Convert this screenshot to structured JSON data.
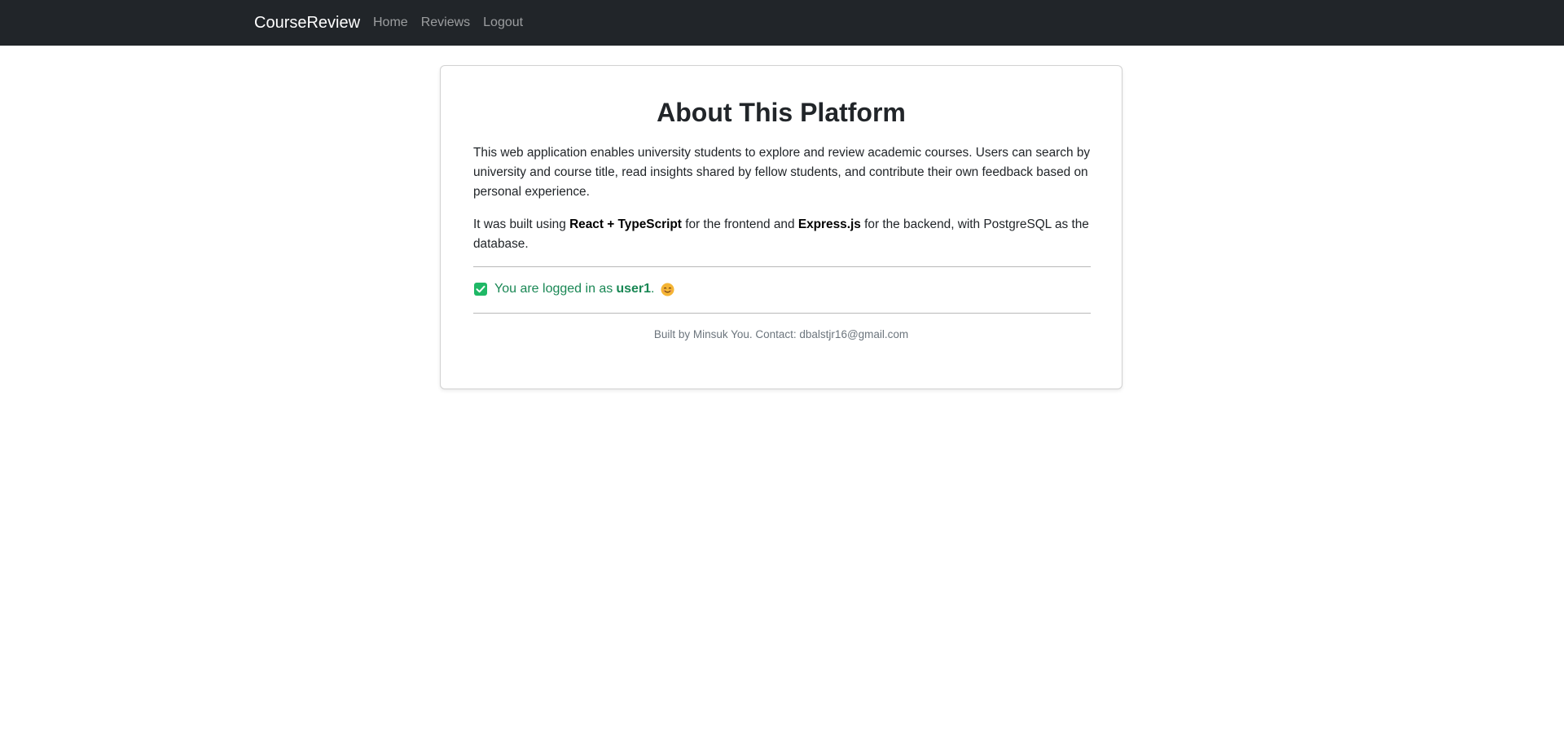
{
  "navbar": {
    "brand": "CourseReview",
    "links": [
      "Home",
      "Reviews",
      "Logout"
    ]
  },
  "card": {
    "title": "About This Platform",
    "paragraph1": "This web application enables university students to explore and review academic courses. Users can search by university and course title, read insights shared by fellow students, and contribute their own feedback based on personal experience.",
    "paragraph2": {
      "prefix": "It was built using ",
      "frontend": "React + TypeScript",
      "middle": " for the frontend and ",
      "backend": "Express.js",
      "suffix": " for the backend, with PostgreSQL as the database."
    },
    "login_status": {
      "prefix": "You are logged in as",
      "username": "user1",
      "suffix": ".",
      "check_icon": "check-square-icon",
      "emoji_icon": "smiling-face-icon"
    },
    "footer": "Built by Minsuk You. Contact: dbalstjr16@gmail.com"
  },
  "colors": {
    "navbar_bg": "#212529",
    "success": "#198754",
    "muted": "#6c757d"
  }
}
